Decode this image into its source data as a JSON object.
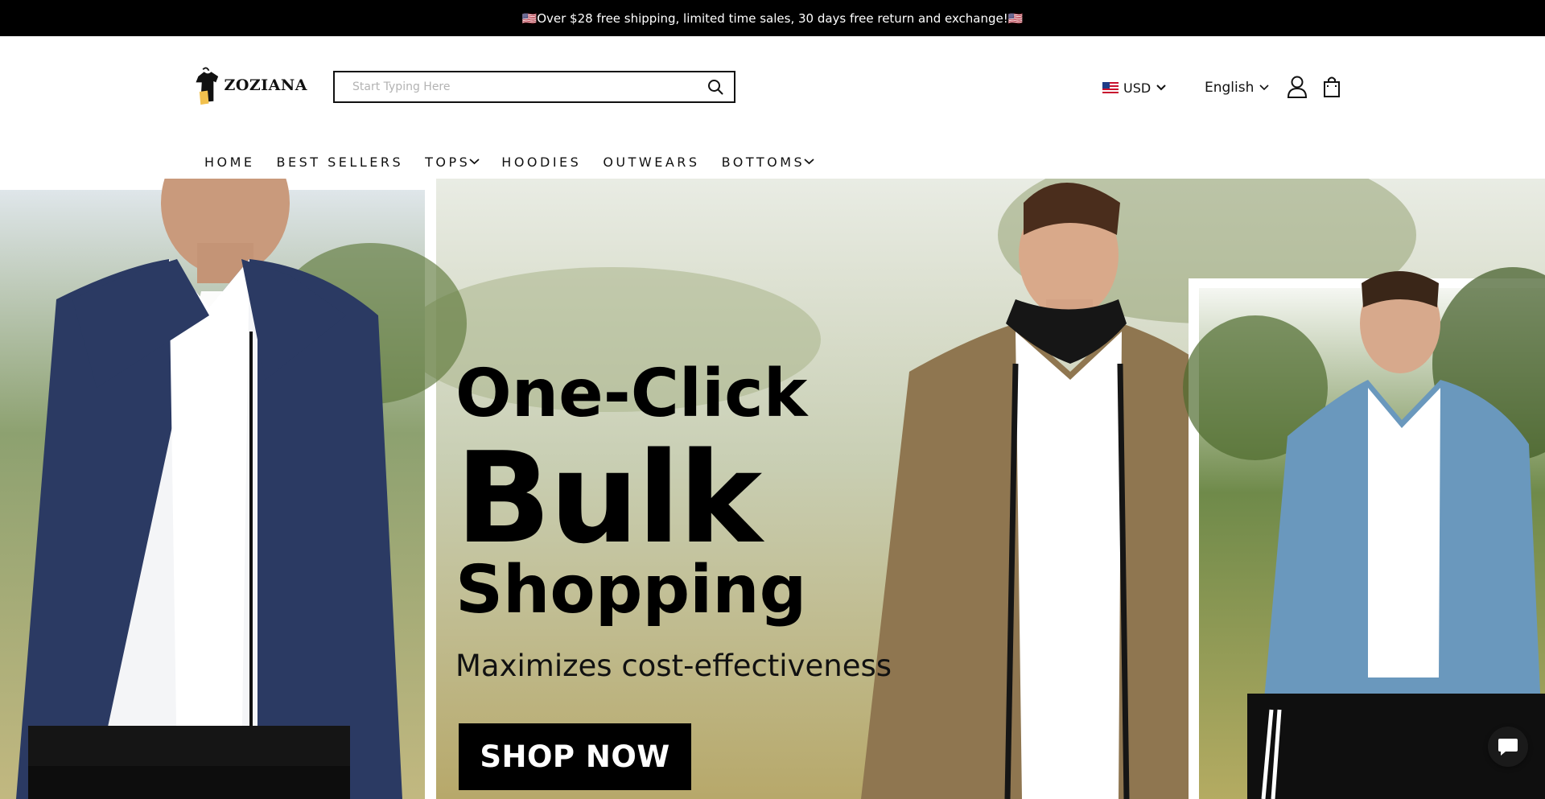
{
  "announcement": {
    "text": "🇺🇸Over $28 free shipping, limited time sales, 30 days free return and exchange!🇺🇸"
  },
  "brand": {
    "name": "ZOZIANA"
  },
  "search": {
    "placeholder": "Start Typing Here",
    "value": ""
  },
  "header": {
    "currency": "USD",
    "language": "English"
  },
  "nav": {
    "items": [
      {
        "label": "HOME",
        "has_dropdown": false
      },
      {
        "label": "BEST SELLERS",
        "has_dropdown": false
      },
      {
        "label": "TOPS",
        "has_dropdown": true
      },
      {
        "label": "HOODIES",
        "has_dropdown": false
      },
      {
        "label": "OUTWEARS",
        "has_dropdown": false
      },
      {
        "label": "BOTTOMS",
        "has_dropdown": true
      }
    ]
  },
  "hero": {
    "line1": "One-Click",
    "line2": "Bulk",
    "line3": "Shopping",
    "subtitle": "Maximizes cost-effectiveness",
    "cta": "SHOP NOW"
  },
  "icons": {
    "search": "search-icon",
    "account": "user-icon",
    "cart": "shopping-bag-icon",
    "chat": "chat-bubble-icon",
    "flag": "us-flag-icon"
  },
  "colors": {
    "announcement_bg": "#000000",
    "cta_bg": "#000000",
    "jacket_navy": "#2b3a63",
    "jacket_khaki": "#8f7650",
    "jacket_blue": "#6a98bd"
  }
}
